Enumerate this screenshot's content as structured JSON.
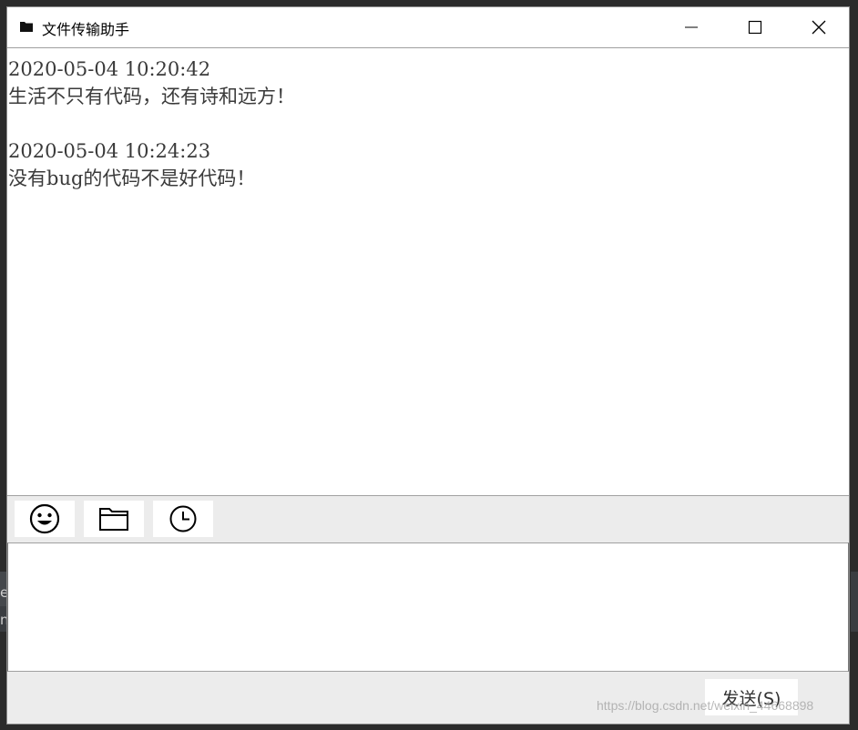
{
  "window": {
    "title": "文件传输助手",
    "icons": {
      "app": "folder-icon",
      "minimize": "minimize-icon",
      "maximize": "maximize-icon",
      "close": "close-icon"
    }
  },
  "chat": {
    "messages": [
      {
        "time": "2020-05-04 10:20:42",
        "text": "生活不只有代码，还有诗和远方！"
      },
      {
        "time": "2020-05-04 10:24:23",
        "text": "没有bug的代码不是好代码！"
      }
    ]
  },
  "toolbar": {
    "tools": [
      {
        "icon": "emoji-icon"
      },
      {
        "icon": "folder-icon"
      },
      {
        "icon": "clock-icon"
      }
    ]
  },
  "input": {
    "value": ""
  },
  "send_label": "发送(S)",
  "background": {
    "left_glyph_1": "e",
    "left_glyph_2": "n"
  },
  "watermark": "https://blog.csdn.net/weixin_44668898"
}
